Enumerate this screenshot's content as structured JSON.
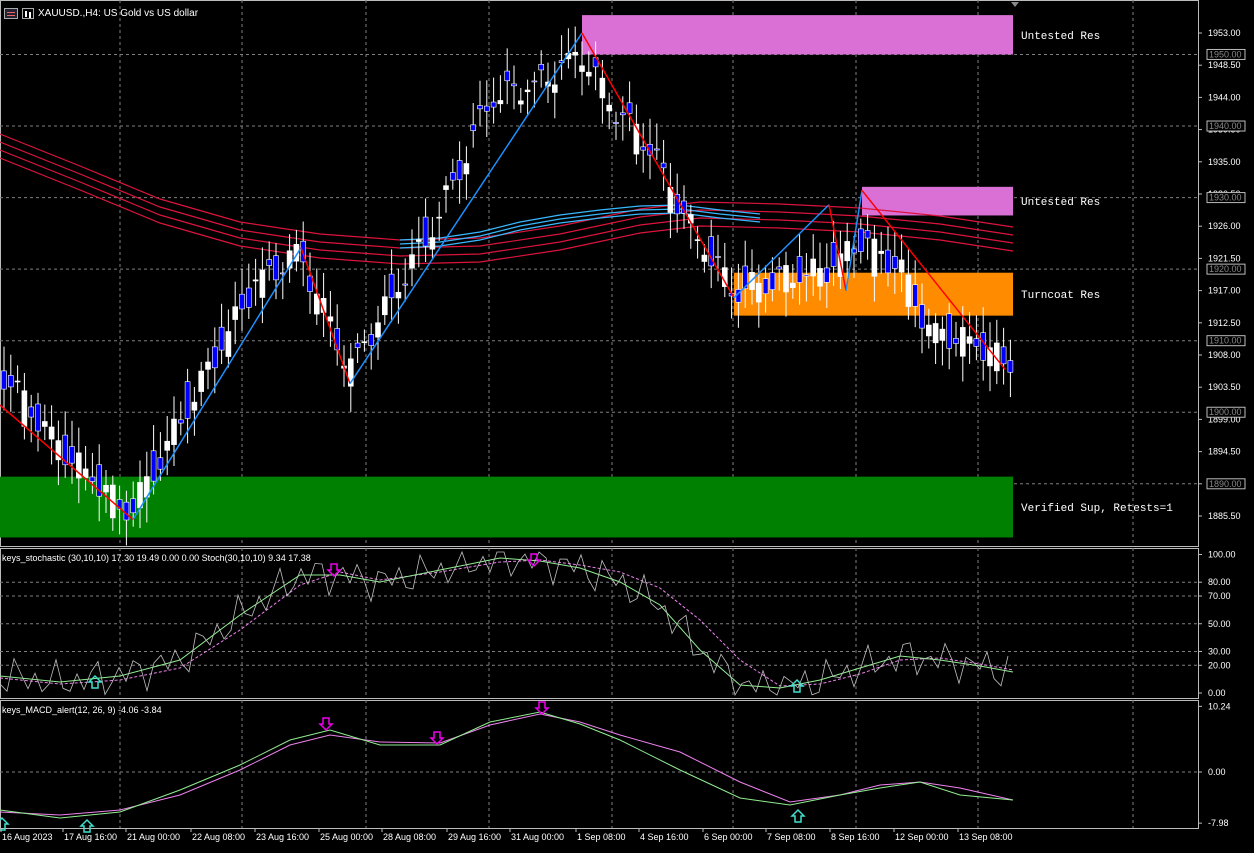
{
  "header": {
    "title": "XAUUSD.,H4:  US Gold vs US dollar"
  },
  "price_axis": {
    "labels": [
      "1953.00",
      "1948.50",
      "1944.00",
      "1939.50",
      "1935.00",
      "1930.50",
      "1926.00",
      "1921.50",
      "1917.00",
      "1912.50",
      "1908.00",
      "1903.50",
      "1899.00",
      "1894.50",
      "1890.00",
      "1885.50"
    ],
    "boxed_levels": [
      "1950.00",
      "1940.00",
      "1930.00",
      "1920.00",
      "1910.00",
      "1900.00",
      "1890.00"
    ]
  },
  "time_axis": {
    "labels": [
      "16 Aug 2023",
      "17 Aug 16:00",
      "21 Aug 00:00",
      "22 Aug 08:00",
      "23 Aug 16:00",
      "25 Aug 00:00",
      "28 Aug 08:00",
      "29 Aug 16:00",
      "31 Aug 00:00",
      "1 Sep 08:00",
      "4 Sep 16:00",
      "6 Sep 00:00",
      "7 Sep 08:00",
      "8 Sep 16:00",
      "12 Sep 00:00",
      "13 Sep 08:00"
    ]
  },
  "zones": [
    {
      "label": "Untested Res",
      "color": "#DA70D6"
    },
    {
      "label": "Untested Res",
      "color": "#DA70D6"
    },
    {
      "label": "Turncoat Res",
      "color": "#FF8C00"
    },
    {
      "label": "Verified Sup, Retests=1",
      "color": "#008000"
    }
  ],
  "stochastic": {
    "label": "keys_stochastic (30,10,10) 17.30 19.49 0.00 0.00 Stoch(30,10,10) 9.34 17.38",
    "axis_labels": [
      "100.00",
      "80.00",
      "70.00",
      "50.00",
      "30.00",
      "20.00",
      "0.00"
    ]
  },
  "macd": {
    "label": "keys_MACD_alert(12, 26, 9) -4.06 -3.84",
    "axis_labels": [
      "10.24",
      "0.00",
      "-7.98"
    ]
  },
  "colors": {
    "bull_candle": "#FFFFFF",
    "bear_candle": "#0000FF",
    "zigzag_up": "#1E90FF",
    "zigzag_down": "#FF0000",
    "ema_red": "#DC143C",
    "ema_blue": "#1E90FF",
    "grid": "#7f7f7f",
    "stoch_main": "#C0C0C0",
    "stoch_signal": "#EE82EE",
    "macd_main": "#90EE90",
    "macd_signal": "#EE82EE",
    "arrow_sell": "#EE00EE",
    "arrow_buy": "#40E0D0"
  },
  "icons": [
    "chart-bars-icon",
    "chart-candle-icon",
    "arrow-down-icon",
    "arrow-up-icon"
  ],
  "chart_data": {
    "type": "line",
    "symbol": "XAUUSD.",
    "timeframe": "H4",
    "x": [
      "16 Aug 2023",
      "17 Aug 16:00",
      "21 Aug 00:00",
      "22 Aug 08:00",
      "23 Aug 16:00",
      "25 Aug 00:00",
      "28 Aug 08:00",
      "29 Aug 16:00",
      "31 Aug 00:00",
      "1 Sep 08:00",
      "4 Sep 16:00",
      "6 Sep 00:00",
      "7 Sep 08:00",
      "8 Sep 16:00",
      "12 Sep 00:00",
      "13 Sep 08:00"
    ],
    "ylim": [
      1883,
      1957
    ],
    "zigzag": [
      {
        "t": "16 Aug 2023",
        "price": 1901
      },
      {
        "t": "21 Aug 00:00",
        "price": 1885
      },
      {
        "t": "23 Aug 16:00",
        "price": 1923
      },
      {
        "t": "25 Aug 00:00",
        "price": 1904
      },
      {
        "t": "1 Sep 08:00",
        "price": 1953
      },
      {
        "t": "6 Sep 00:00",
        "price": 1916
      },
      {
        "t": "7 Sep 08:00",
        "price": 1929
      },
      {
        "t": "8 Sep 16:00",
        "price": 1917
      },
      {
        "t": "8 Sep 16:00",
        "price": 1931
      },
      {
        "t": "13 Sep 08:00",
        "price": 1906
      }
    ],
    "zones_price": [
      {
        "low": 1950,
        "high": 1955.5
      },
      {
        "low": 1927.5,
        "high": 1931.5
      },
      {
        "low": 1913.5,
        "high": 1919.5
      },
      {
        "low": 1882.5,
        "high": 1891
      }
    ],
    "stochastic_range": [
      0,
      100
    ],
    "macd_range": [
      -7.98,
      10.24
    ]
  }
}
